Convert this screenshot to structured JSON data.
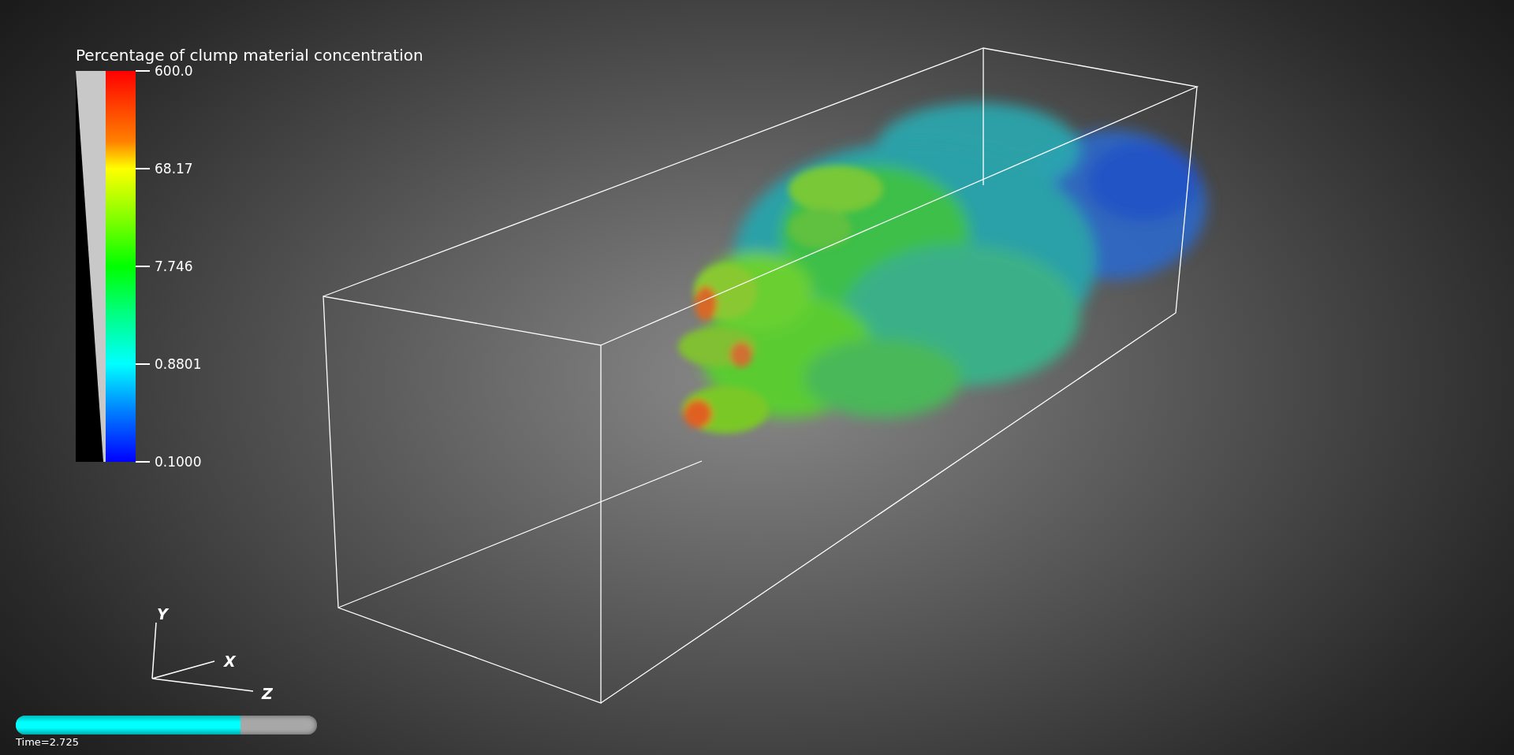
{
  "color_legend": {
    "title": "Percentage of clump material concentration",
    "ticks": [
      "600.0",
      "68.17",
      "7.746",
      "0.8801",
      "0.1000"
    ]
  },
  "orientation_axes": {
    "labels": [
      "Y",
      "X",
      "Z"
    ]
  },
  "time_bar": {
    "level": 0.745,
    "label": "Time=2.725"
  }
}
